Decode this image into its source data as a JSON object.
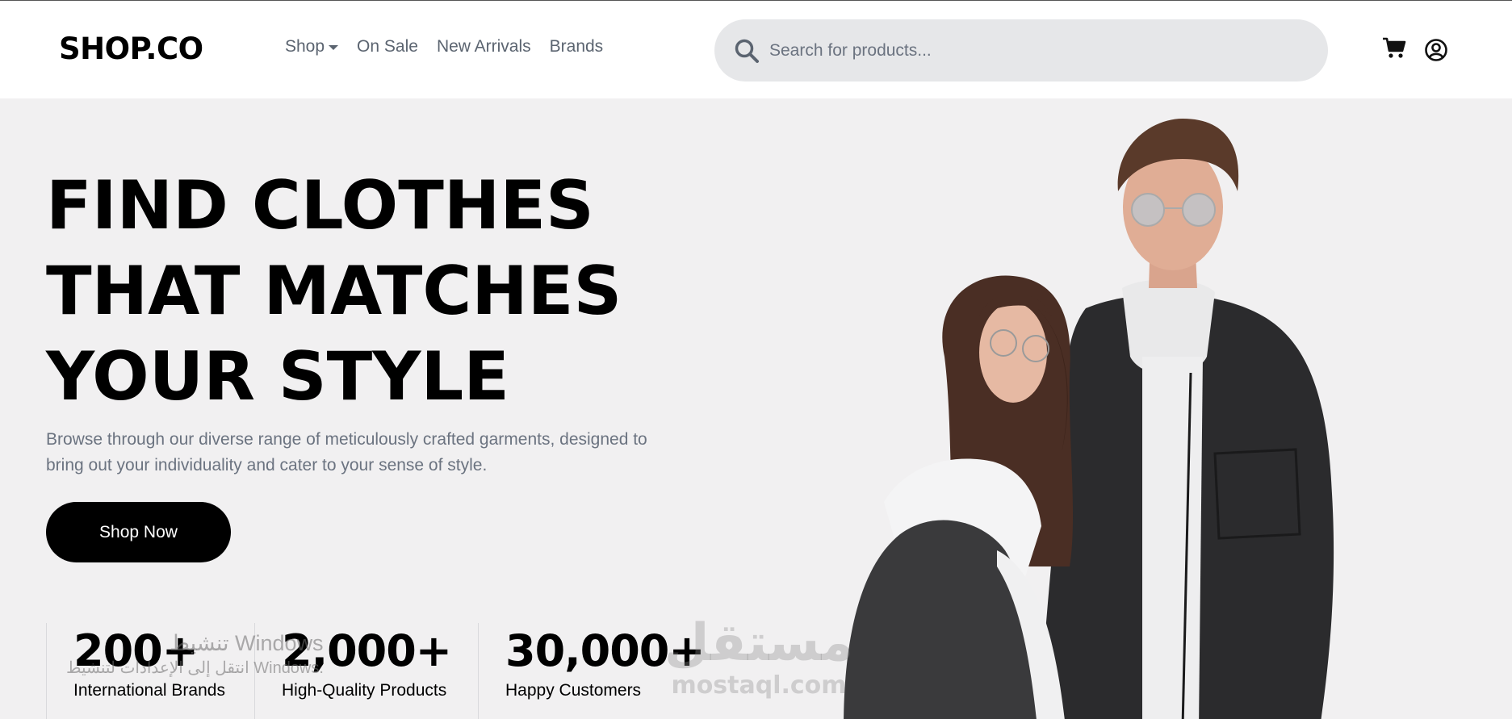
{
  "brand": {
    "logo": "SHOP.CO"
  },
  "nav": {
    "items": [
      {
        "label": "Shop",
        "has_dropdown": true
      },
      {
        "label": "On Sale"
      },
      {
        "label": "New Arrivals"
      },
      {
        "label": "Brands"
      }
    ]
  },
  "search": {
    "placeholder": "Search for products..."
  },
  "icons": {
    "search": "search-icon",
    "cart": "cart-icon",
    "account": "user-circle-icon"
  },
  "hero": {
    "title_lines": [
      "FIND CLOTHES",
      "THAT MATCHES",
      "YOUR STYLE"
    ],
    "description": "Browse through our diverse range of meticulously crafted garments, designed to bring out your individuality and cater to your sense of style.",
    "cta": "Shop Now"
  },
  "stats": [
    {
      "value": "200+",
      "label": "International Brands"
    },
    {
      "value": "2,000+",
      "label": "High-Quality Products"
    },
    {
      "value": "30,000+",
      "label": "Happy Customers"
    }
  ],
  "overlays": {
    "windows_line1": "تنشيط Windows",
    "windows_line2": "انتقل إلى الإعدادات لتنشيط Windows.",
    "mostaql_ar": "مستقل",
    "mostaql_en": "mostaql.com"
  },
  "colors": {
    "accent": "#000000",
    "hero_bg": "#f1f0f1",
    "search_bg": "#e6e7e9",
    "muted_text": "#6b7380"
  }
}
